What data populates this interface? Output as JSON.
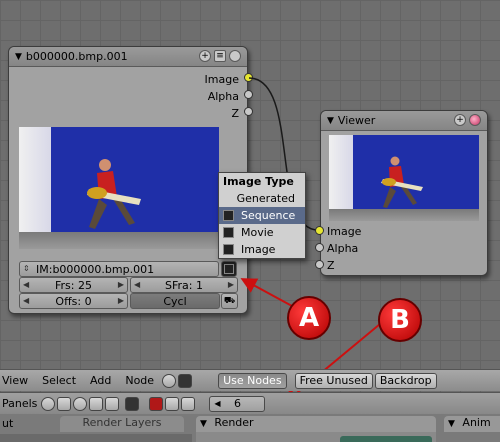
{
  "image_node": {
    "title": "b000000.bmp.001",
    "outputs": [
      "Image",
      "Alpha",
      "Z"
    ],
    "image_field": "IM:b000000.bmp.001",
    "frs": "Frs: 25",
    "sfra": "SFra: 1",
    "offs": "Offs: 0",
    "cycl": "Cycl"
  },
  "image_type_menu": {
    "title": "Image Type",
    "items": [
      {
        "label": "Generated",
        "selected": false
      },
      {
        "label": "Sequence",
        "selected": true
      },
      {
        "label": "Movie",
        "selected": false
      },
      {
        "label": "Image",
        "selected": false
      }
    ]
  },
  "viewer_node": {
    "title": "Viewer",
    "inputs": [
      "Image",
      "Alpha",
      "Z"
    ]
  },
  "callouts": [
    "A",
    "B"
  ],
  "node_editor_header": {
    "menus": [
      "View",
      "Select",
      "Add",
      "Node"
    ],
    "use_nodes": "Use Nodes",
    "free_unused": "Free Unused",
    "backdrop": "Backdrop"
  },
  "buttons_header": {
    "panels_label": "Panels",
    "frame_value": "6"
  },
  "panel_tabs": {
    "left_partial": "ut",
    "render_layers": "Render Layers",
    "render": "Render",
    "anim_partial": "Anim"
  },
  "colors": {
    "accent_red": "#cc1010",
    "socket_yellow": "#e6e632",
    "selection": "#5a6a8a"
  }
}
